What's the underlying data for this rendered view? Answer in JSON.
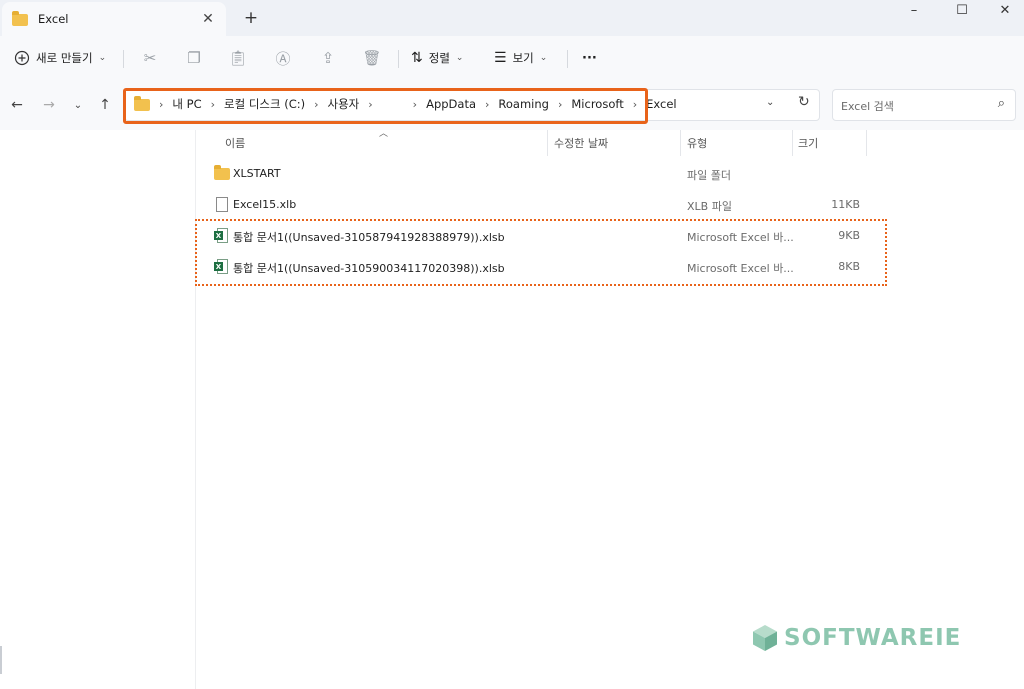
{
  "window": {
    "tab_title": "Excel",
    "controls": {
      "minimize": "–",
      "maximize": "☐",
      "close": "✕"
    }
  },
  "toolbar": {
    "new_label": "새로 만들기",
    "sort_label": "정렬",
    "view_label": "보기",
    "more_label": "···",
    "disabled_icons": [
      "cut-icon",
      "copy-icon",
      "paste-icon",
      "rename-icon",
      "share-icon",
      "delete-icon"
    ]
  },
  "address": {
    "crumbs": [
      "내 PC",
      "로컬 디스크 (C:)",
      "사용자",
      "",
      "AppData",
      "Roaming",
      "Microsoft",
      "Excel"
    ],
    "search_placeholder": "Excel 검색"
  },
  "columns": {
    "name": "이름",
    "modified": "수정한 날짜",
    "type": "유형",
    "size": "크기"
  },
  "files": [
    {
      "name": "XLSTART",
      "type": "파일 폴더",
      "size": "",
      "icon": "folder-icon"
    },
    {
      "name": "Excel15.xlb",
      "type": "XLB 파일",
      "size": "11KB",
      "icon": "file-icon"
    },
    {
      "name": "통합 문서1((Unsaved-310587941928388979)).xlsb",
      "type": "Microsoft Excel 바...",
      "size": "9KB",
      "icon": "excel-icon"
    },
    {
      "name": "통합 문서1((Unsaved-310590034117020398)).xlsb",
      "type": "Microsoft Excel 바...",
      "size": "8KB",
      "icon": "excel-icon"
    }
  ],
  "colors": {
    "highlight": "#e8631a",
    "watermark": "#8ec7b0"
  },
  "watermark": {
    "text": "SOFTWAREIE"
  }
}
